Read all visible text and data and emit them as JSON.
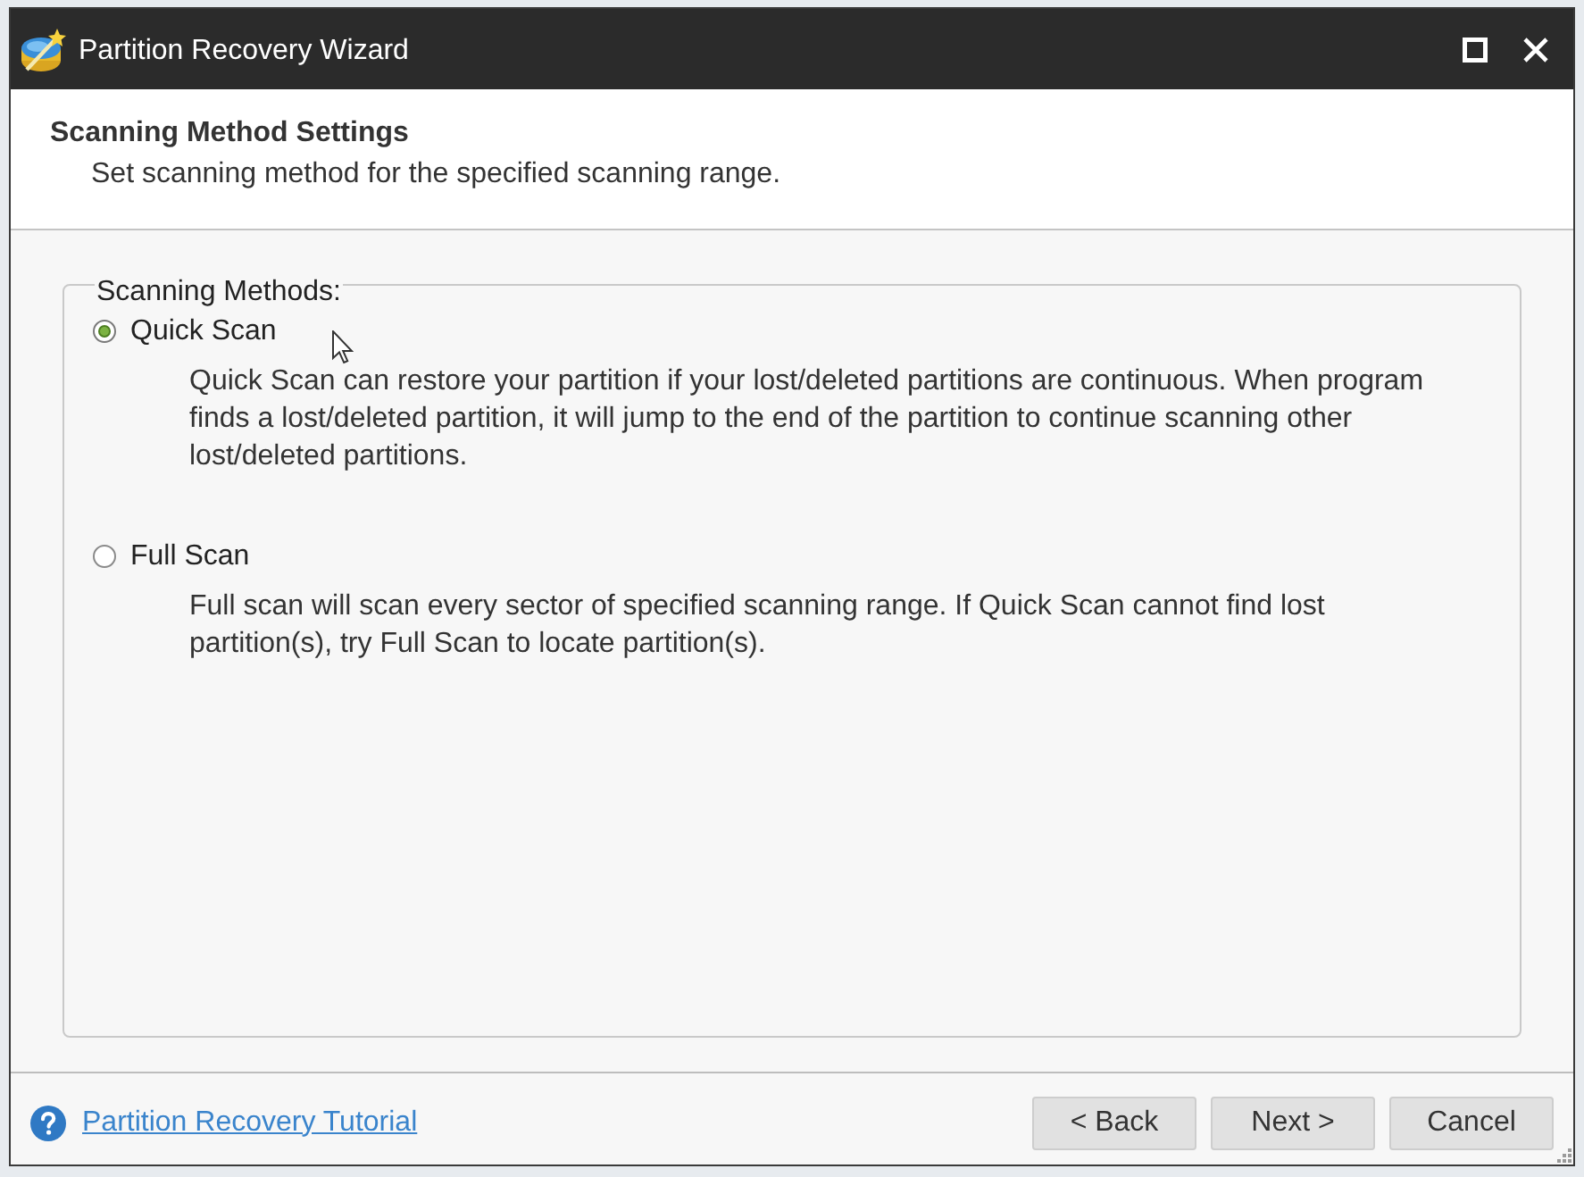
{
  "window": {
    "title": "Partition Recovery Wizard"
  },
  "header": {
    "title": "Scanning Method Settings",
    "subtitle": "Set scanning method for the specified scanning range."
  },
  "scanning_methods": {
    "legend": "Scanning Methods:",
    "options": [
      {
        "label": "Quick Scan",
        "selected": true,
        "description": "Quick Scan can restore your partition if your lost/deleted partitions are continuous. When program finds a lost/deleted partition, it will jump to the end of the partition to continue scanning other lost/deleted partitions."
      },
      {
        "label": "Full Scan",
        "selected": false,
        "description": "Full scan will scan every sector of specified scanning range. If Quick Scan cannot find lost partition(s), try Full Scan to locate partition(s)."
      }
    ]
  },
  "footer": {
    "help_link": "Partition Recovery Tutorial",
    "buttons": [
      "< Back",
      "Next >",
      "Cancel"
    ]
  }
}
